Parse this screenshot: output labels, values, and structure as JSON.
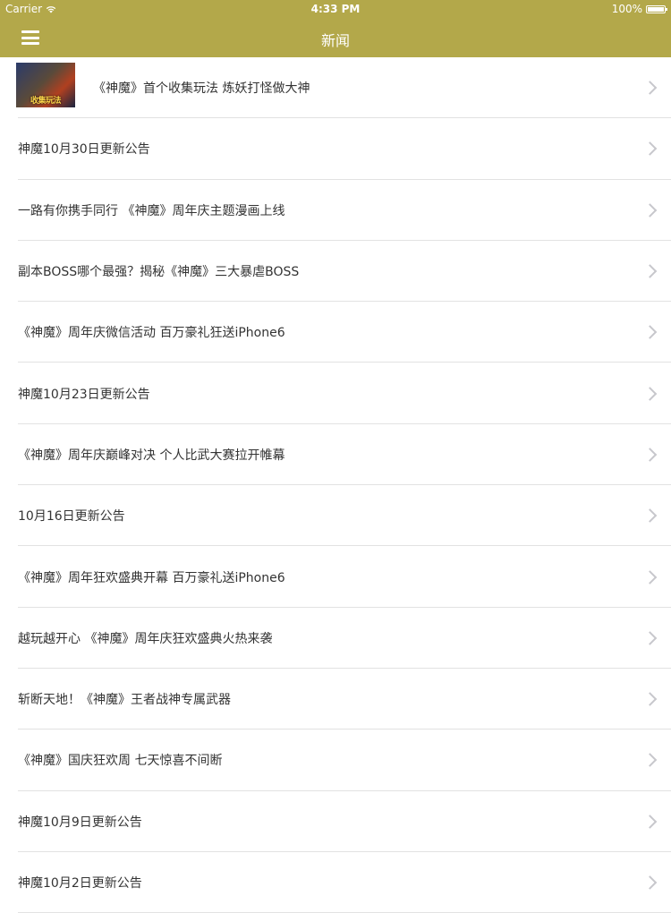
{
  "status_bar": {
    "carrier": "Carrier",
    "time": "4:33 PM",
    "battery": "100%"
  },
  "nav": {
    "title": "新闻",
    "menu_icon": "hamburger-icon"
  },
  "news": [
    {
      "title": "《神魔》首个收集玩法  炼妖打怪做大神",
      "thumb_caption": "收集玩法"
    },
    {
      "title": "神魔10月30日更新公告"
    },
    {
      "title": "一路有你携手同行  《神魔》周年庆主题漫画上线"
    },
    {
      "title": "副本BOSS哪个最强？揭秘《神魔》三大暴虐BOSS"
    },
    {
      "title": "《神魔》周年庆微信活动  百万豪礼狂送iPhone6"
    },
    {
      "title": "神魔10月23日更新公告"
    },
    {
      "title": "《神魔》周年庆巅峰对决  个人比武大赛拉开帷幕"
    },
    {
      "title": "10月16日更新公告"
    },
    {
      "title": "《神魔》周年狂欢盛典开幕   百万豪礼送iPhone6"
    },
    {
      "title": "越玩越开心  《神魔》周年庆狂欢盛典火热来袭"
    },
    {
      "title": "斩断天地！《神魔》王者战神专属武器"
    },
    {
      "title": "《神魔》国庆狂欢周 七天惊喜不间断"
    },
    {
      "title": "神魔10月9日更新公告"
    },
    {
      "title": "神魔10月2日更新公告"
    }
  ],
  "colors": {
    "nav_background": "#b3a84a",
    "text": "#333333",
    "separator": "#e2e2e2",
    "chevron": "#c7c7cc"
  }
}
